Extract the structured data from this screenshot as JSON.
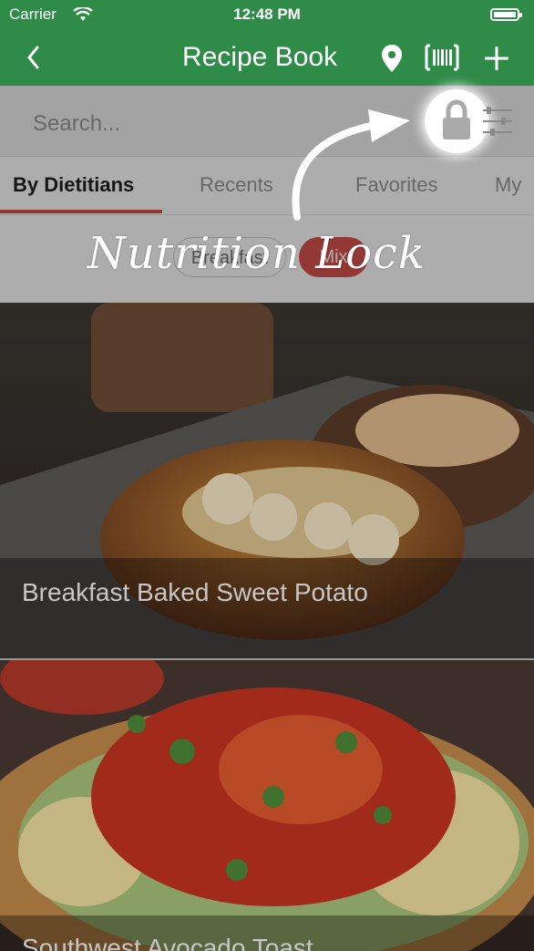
{
  "status_bar": {
    "carrier": "Carrier",
    "time": "12:48 PM"
  },
  "nav": {
    "title": "Recipe Book",
    "back_icon": "chevron-left-icon",
    "location_icon": "map-pin-icon",
    "barcode_icon": "barcode-icon",
    "add_icon": "plus-icon"
  },
  "search": {
    "placeholder": "Search..."
  },
  "tabs": [
    {
      "label": "By Dietitians"
    },
    {
      "label": "Recents"
    },
    {
      "label": "Favorites"
    },
    {
      "label": "My"
    }
  ],
  "chips": [
    {
      "label": "Breakfast"
    },
    {
      "label": "Mix"
    }
  ],
  "recipes": [
    {
      "title": "Breakfast Baked Sweet Potato"
    },
    {
      "title": "Southwest Avocado Toast"
    }
  ],
  "tutorial": {
    "label": "Nutrition Lock"
  },
  "colors": {
    "brand_green": "#2f8b48",
    "accent_red": "#d9534f"
  }
}
